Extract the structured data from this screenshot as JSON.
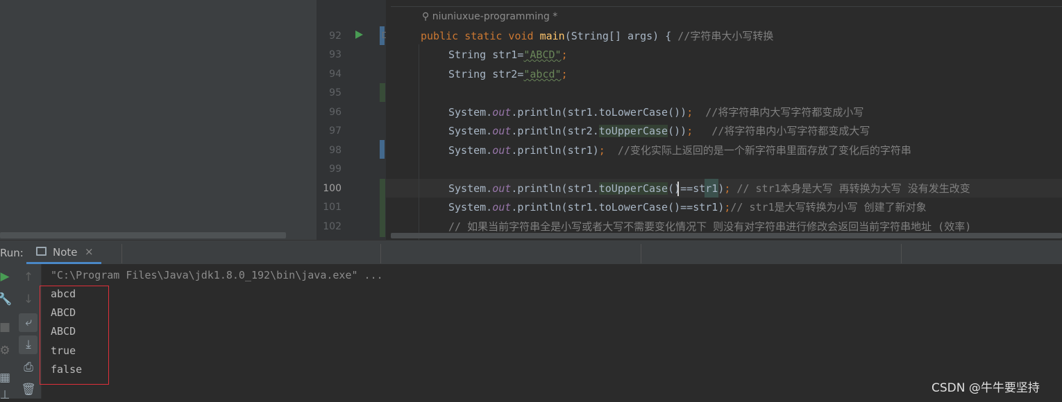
{
  "editor": {
    "author_hint": "niuniuxue-programming *",
    "current_line": "100",
    "lines": [
      {
        "num": "92"
      },
      {
        "num": "93"
      },
      {
        "num": "94"
      },
      {
        "num": "95"
      },
      {
        "num": "96"
      },
      {
        "num": "97"
      },
      {
        "num": "98"
      },
      {
        "num": "99"
      },
      {
        "num": "100"
      },
      {
        "num": "101"
      },
      {
        "num": "102"
      }
    ],
    "code": {
      "l92": {
        "kw": "public static void ",
        "fn": "main",
        "rest": "(String[] args) { ",
        "cmt": "//字符串大小写转换"
      },
      "l93": {
        "pre": "String str1=",
        "str": "\"ABCD\"",
        "post": ";"
      },
      "l94": {
        "pre": "String str2=",
        "str": "\"abcd\"",
        "post": ";"
      },
      "l96": {
        "a": "System.",
        "fld": "out",
        "b": ".println(str1.toLowerCase())",
        "semi": ";",
        "cmt": "  //将字符串内大写字符都变成小写"
      },
      "l97": {
        "a": "System.",
        "fld": "out",
        "b": ".println(str2.",
        "hl": "toUpperCase",
        "c": "())",
        "semi": ";",
        "cmt": "   //将字符串内小写字符都变成大写"
      },
      "l98": {
        "a": "System.",
        "fld": "out",
        "b": ".println(str1)",
        "semi": ";",
        "cmt": "  //变化实际上返回的是一个新字符串里面存放了变化后的字符串"
      },
      "l100": {
        "a": "System.",
        "fld": "out",
        "b": ".println(str1.",
        "hl": "toUpperCase",
        "c": "()==str1)",
        "semi": ";",
        "cmt": " // str1本身是大写 再转换为大写 没有发生改变"
      },
      "l101": {
        "a": "System.",
        "fld": "out",
        "b": ".println(str1.toLowerCase()==str1)",
        "semi": ";",
        "cmt": "// str1是大写转换为小写 创建了新对象"
      },
      "l102": {
        "cmt": "// 如果当前字符串全是小写或者大写不需要变化情况下 则没有对字符串进行修改会返回当前字符串地址 (效率)"
      }
    }
  },
  "run_window": {
    "label": "Run:",
    "tab_label": "Note",
    "tab_close": "×",
    "command": "\"C:\\Program Files\\Java\\jdk1.8.0_192\\bin\\java.exe\" ...",
    "output": [
      "abcd",
      "ABCD",
      "ABCD",
      "true",
      "false"
    ]
  },
  "icons": {
    "rerun": "play-icon",
    "wrench": "wrench-icon",
    "up": "arrow-up-icon",
    "down": "arrow-down-icon",
    "wrap": "soft-wrap-icon",
    "scroll": "scroll-to-end-icon",
    "print": "print-icon",
    "trash": "trash-icon"
  },
  "colors": {
    "keyword": "#cc7832",
    "function": "#ffc66d",
    "string": "#6a8759",
    "field": "#9876aa",
    "comment": "#808080",
    "highlight_box": "#e0303a"
  },
  "watermark": "CSDN @牛牛要坚持"
}
